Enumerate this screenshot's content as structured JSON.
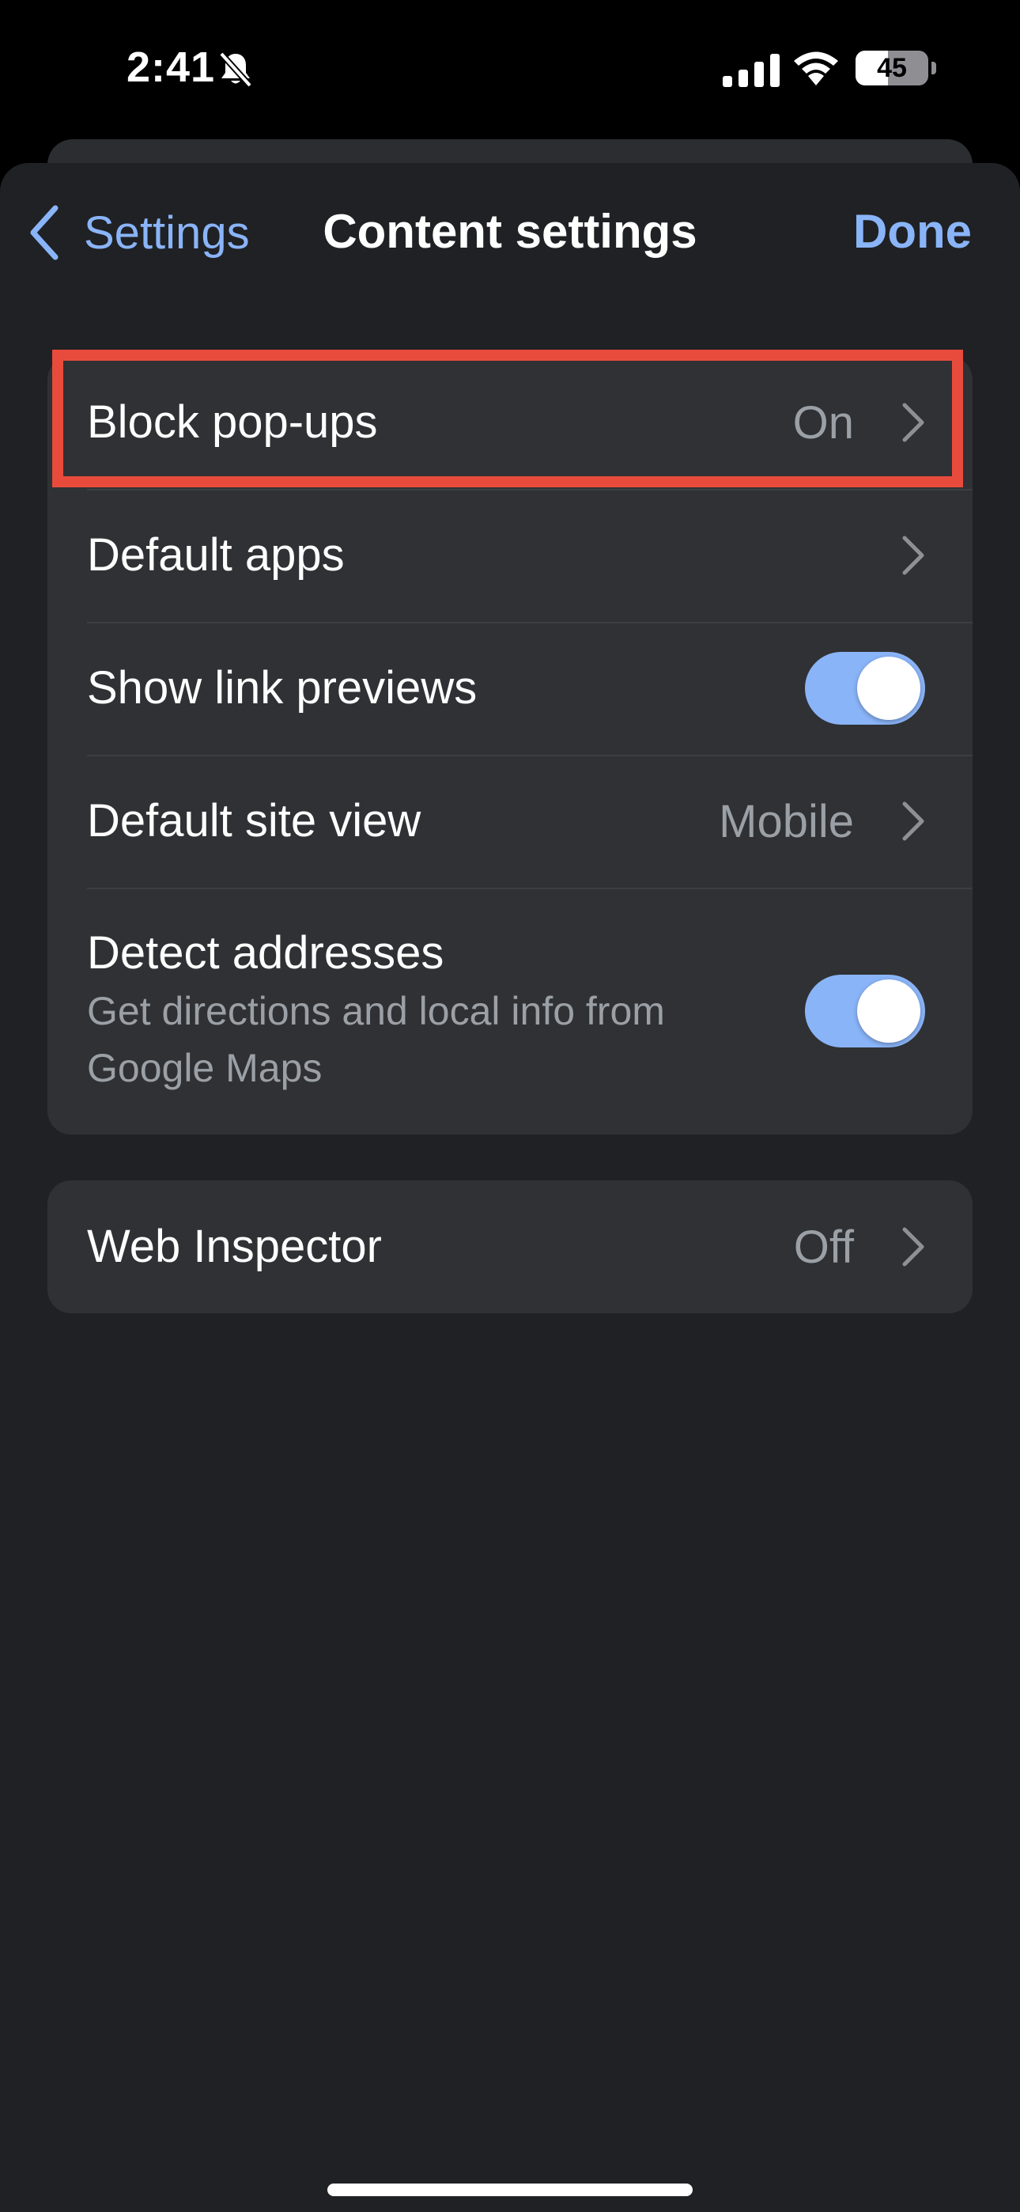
{
  "status_bar": {
    "time": "2:41",
    "battery_level": "45",
    "battery_fraction": 0.45,
    "icons": [
      "bell-slash-icon",
      "cellular-signal-icon",
      "wifi-icon",
      "battery-icon"
    ]
  },
  "nav": {
    "back_label": "Settings",
    "title": "Content settings",
    "done_label": "Done"
  },
  "groups": {
    "main": {
      "rows": [
        {
          "title": "Block pop-ups",
          "value": "On",
          "type": "disclosure"
        },
        {
          "title": "Default apps",
          "value": "",
          "type": "disclosure"
        },
        {
          "title": "Show link previews",
          "type": "toggle",
          "on": true
        },
        {
          "title": "Default site view",
          "value": "Mobile",
          "type": "disclosure"
        },
        {
          "title": "Detect addresses",
          "subtitle": "Get directions and local info from Google Maps",
          "type": "toggle",
          "on": true
        }
      ]
    },
    "inspector": {
      "rows": [
        {
          "title": "Web Inspector",
          "value": "Off",
          "type": "disclosure"
        }
      ]
    }
  },
  "colors": {
    "accent": "#8ab4f8",
    "sheet_background": "#202124",
    "group_background": "#303134",
    "secondary_text": "#9aa0a6",
    "highlight": "#e84b3c"
  }
}
